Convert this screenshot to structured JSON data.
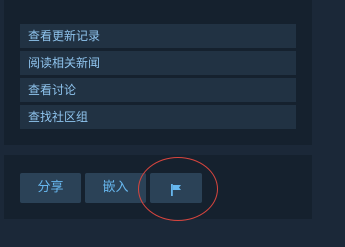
{
  "links": [
    {
      "label": "查看更新记录"
    },
    {
      "label": "阅读相关新闻"
    },
    {
      "label": "查看讨论"
    },
    {
      "label": "查找社区组"
    }
  ],
  "actions": {
    "share_label": "分享",
    "embed_label": "嵌入",
    "report_icon": "flag-icon"
  },
  "colors": {
    "background": "#1b2838",
    "panel": "#15212e",
    "link_bg": "#213243",
    "link_text": "#8fc4ee",
    "button_bg": "#2b4257",
    "button_text": "#67b7ee",
    "annotation": "#d8453e"
  }
}
